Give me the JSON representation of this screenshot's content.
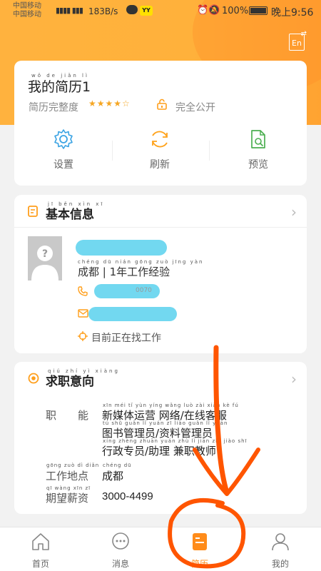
{
  "status_bar": {
    "carrier_1": "中国移动",
    "carrier_2": "中国移动",
    "network": "26 4G",
    "speed": "183B/s",
    "battery": "100%",
    "time": "晚上9:56"
  },
  "header": {
    "language_icon": "En"
  },
  "resume": {
    "title": "我的简历1",
    "title_pinyin": "wǒ de jiǎn lì",
    "completeness_label": "简历完整度",
    "rating": 4,
    "rating_max": 5,
    "visibility": "完全公开"
  },
  "actions": [
    {
      "label": "设置",
      "icon": "gear-icon"
    },
    {
      "label": "刷新",
      "icon": "refresh-icon"
    },
    {
      "label": "预览",
      "icon": "preview-icon"
    }
  ],
  "basic_info": {
    "title": "基本信息",
    "title_pinyin": "jī běn xìn xī",
    "location_experience": "成都 | 1年工作经验",
    "loc_pinyin": "chéng dū   nián gōng zuò jīng yàn",
    "phone_suffix": "0070",
    "job_status": "目前正在找工作"
  },
  "job_intent": {
    "title": "求职意向",
    "title_pinyin": "qiú zhí yì xiàng",
    "function_label": "职　　能",
    "functions": [
      "新媒体运营 网络/在线客服",
      "图书管理员/资料管理员",
      "行政专员/助理 兼职教师"
    ],
    "functions_pinyin": [
      "xīn méi tǐ yùn yíng   wǎng luò   zài xiàn kè fú",
      "tú shū guǎn lǐ yuán   zī liào guǎn lǐ yuán",
      "xíng zhèng zhuān yuán   zhù lǐ   jiān zhí jiào shī"
    ],
    "location_label": "工作地点",
    "location_label_pinyin": "gōng zuò dì diǎn",
    "location": "成都",
    "location_pinyin": "chéng dū",
    "salary_label": "期望薪资",
    "salary_label_pinyin": "qī wàng xīn zī",
    "salary": "3000-4499"
  },
  "tabs": [
    {
      "label": "首页",
      "icon": "home-icon",
      "active": false
    },
    {
      "label": "消息",
      "icon": "message-icon",
      "active": false
    },
    {
      "label": "简历",
      "icon": "resume-icon",
      "active": true
    },
    {
      "label": "我的",
      "icon": "profile-icon",
      "active": false
    }
  ],
  "colors": {
    "accent": "#ff8c1a",
    "header": "#ffb23e",
    "icon_blue": "#3aa3e3",
    "icon_green": "#4caf50",
    "annotation": "#ff5500"
  }
}
